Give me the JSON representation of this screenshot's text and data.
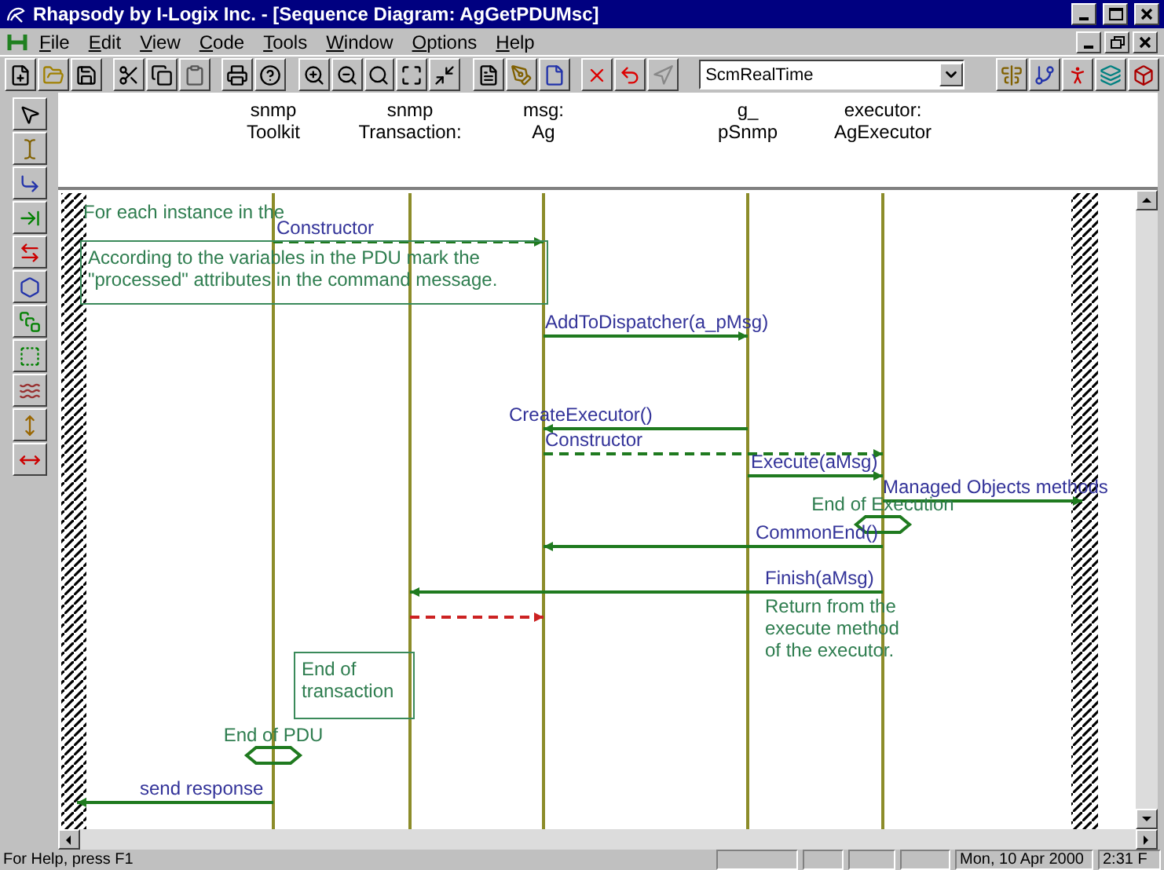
{
  "window": {
    "title": "Rhapsody by I-Logix Inc. - [Sequence Diagram: AgGetPDUMsc]"
  },
  "menu": [
    "File",
    "Edit",
    "View",
    "Code",
    "Tools",
    "Window",
    "Options",
    "Help"
  ],
  "toolbar": {
    "combo_value": "ScmRealTime"
  },
  "instances": [
    {
      "line1": "snmp",
      "line2": "Toolkit"
    },
    {
      "line1": "snmp",
      "line2": "Transaction:"
    },
    {
      "line1": "msg:",
      "line2": "Ag"
    },
    {
      "line1": "g_",
      "line2": "pSnmp"
    },
    {
      "line1": "executor:",
      "line2": "AgExecutor"
    }
  ],
  "messages": [
    {
      "kind": "create",
      "label": "Constructor"
    },
    {
      "kind": "call",
      "label": "AddToDispatcher(a_pMsg)"
    },
    {
      "kind": "call",
      "label": "CreateExecutor()"
    },
    {
      "kind": "create",
      "label": "Constructor"
    },
    {
      "kind": "call",
      "label": "Execute(aMsg)"
    },
    {
      "kind": "call",
      "label": "Managed Objects methods"
    },
    {
      "kind": "call",
      "label": "CommonEnd()"
    },
    {
      "kind": "call",
      "label": "Finish(aMsg)"
    },
    {
      "kind": "cancel"
    },
    {
      "kind": "call",
      "label": "send response"
    }
  ],
  "notes": [
    {
      "kind": "plain",
      "text": "For each instance in the"
    },
    {
      "kind": "box",
      "text": "According to the variables in the PDU mark the \"processed\" attributes in the command message."
    },
    {
      "kind": "plain",
      "text": "Return from the execute method of the executor."
    },
    {
      "kind": "box",
      "text": "End of transaction"
    }
  ],
  "conditions": [
    {
      "label": "End of Execution"
    },
    {
      "label": "End of PDU"
    }
  ],
  "status_bar": {
    "help": "For Help, press F1",
    "date": "Mon, 10 Apr 2000",
    "time": "2:31 F"
  }
}
